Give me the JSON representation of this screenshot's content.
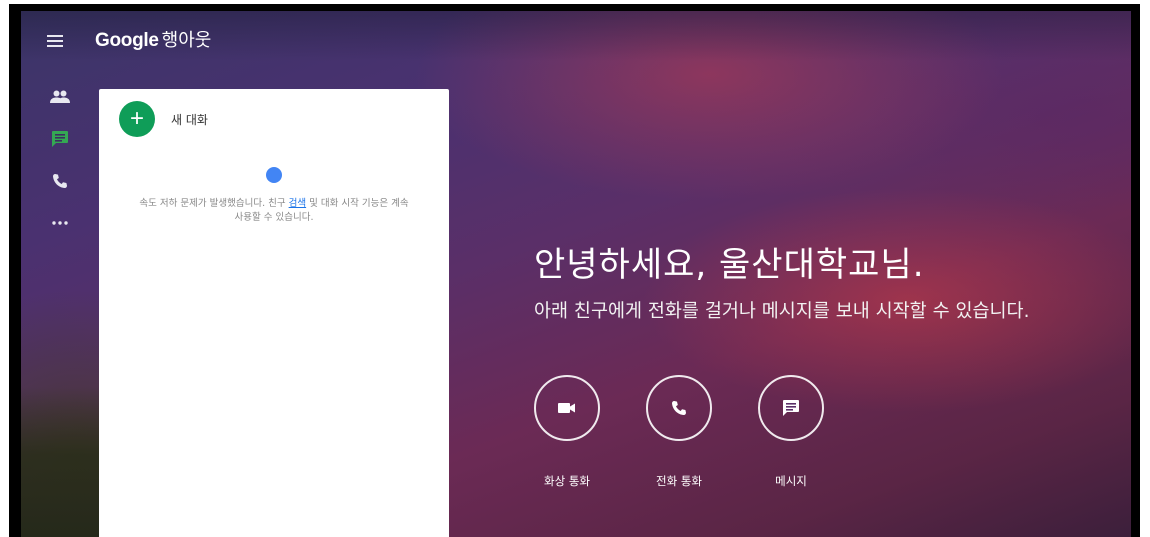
{
  "app": {
    "brand_logo": "Google",
    "brand_product": "행아웃"
  },
  "sidebar": {
    "items": [
      {
        "icon": "people-icon",
        "active": false
      },
      {
        "icon": "chat-icon",
        "active": true
      },
      {
        "icon": "phone-icon",
        "active": false
      },
      {
        "icon": "more-icon",
        "active": false
      }
    ]
  },
  "panel": {
    "new_chat_label": "새 대화",
    "warning_before": "속도 저하 문제가 발생했습니다. 친구 ",
    "warning_link": "검색",
    "warning_after": " 및 대화 시작 기능은 계속",
    "warning_line2": "사용할 수 있습니다."
  },
  "welcome": {
    "greeting": "안녕하세요, 울산대학교님.",
    "subtitle": "아래 친구에게 전화를 걸거나 메시지를 보내 시작할 수 있습니다."
  },
  "actions": [
    {
      "icon": "video-camera-icon",
      "label": "화상 통화"
    },
    {
      "icon": "phone-icon",
      "label": "전화 통화"
    },
    {
      "icon": "message-icon",
      "label": "메시지"
    }
  ],
  "colors": {
    "accent_green": "#0f9d58",
    "loading_blue": "#4285f4",
    "link_blue": "#1a73e8"
  }
}
